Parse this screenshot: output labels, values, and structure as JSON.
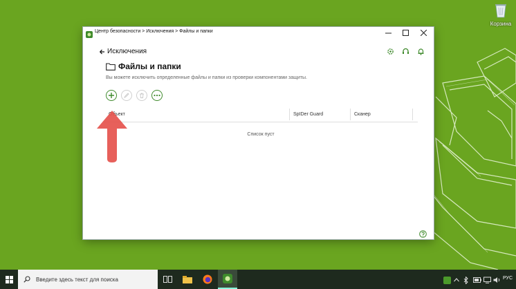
{
  "desktop": {
    "recycle_bin_label": "Корзина"
  },
  "window": {
    "title": "Центр безопасности > Исключения > Файлы и папки",
    "back_label": "Исключения",
    "page_title": "Файлы и папки",
    "description": "Вы можете исключить определенные файлы и папки из проверки компонентами защиты.",
    "table": {
      "columns": [
        "Объект",
        "SpIDer Guard",
        "Сканер"
      ],
      "empty_text": "Список пуст"
    }
  },
  "taskbar": {
    "search_placeholder": "Введите здесь текст для поиска",
    "language": "РУС"
  },
  "colors": {
    "desktop_bg": "#6aa520",
    "accent_green": "#3f8a2c",
    "arrow_red": "#e5524d"
  }
}
